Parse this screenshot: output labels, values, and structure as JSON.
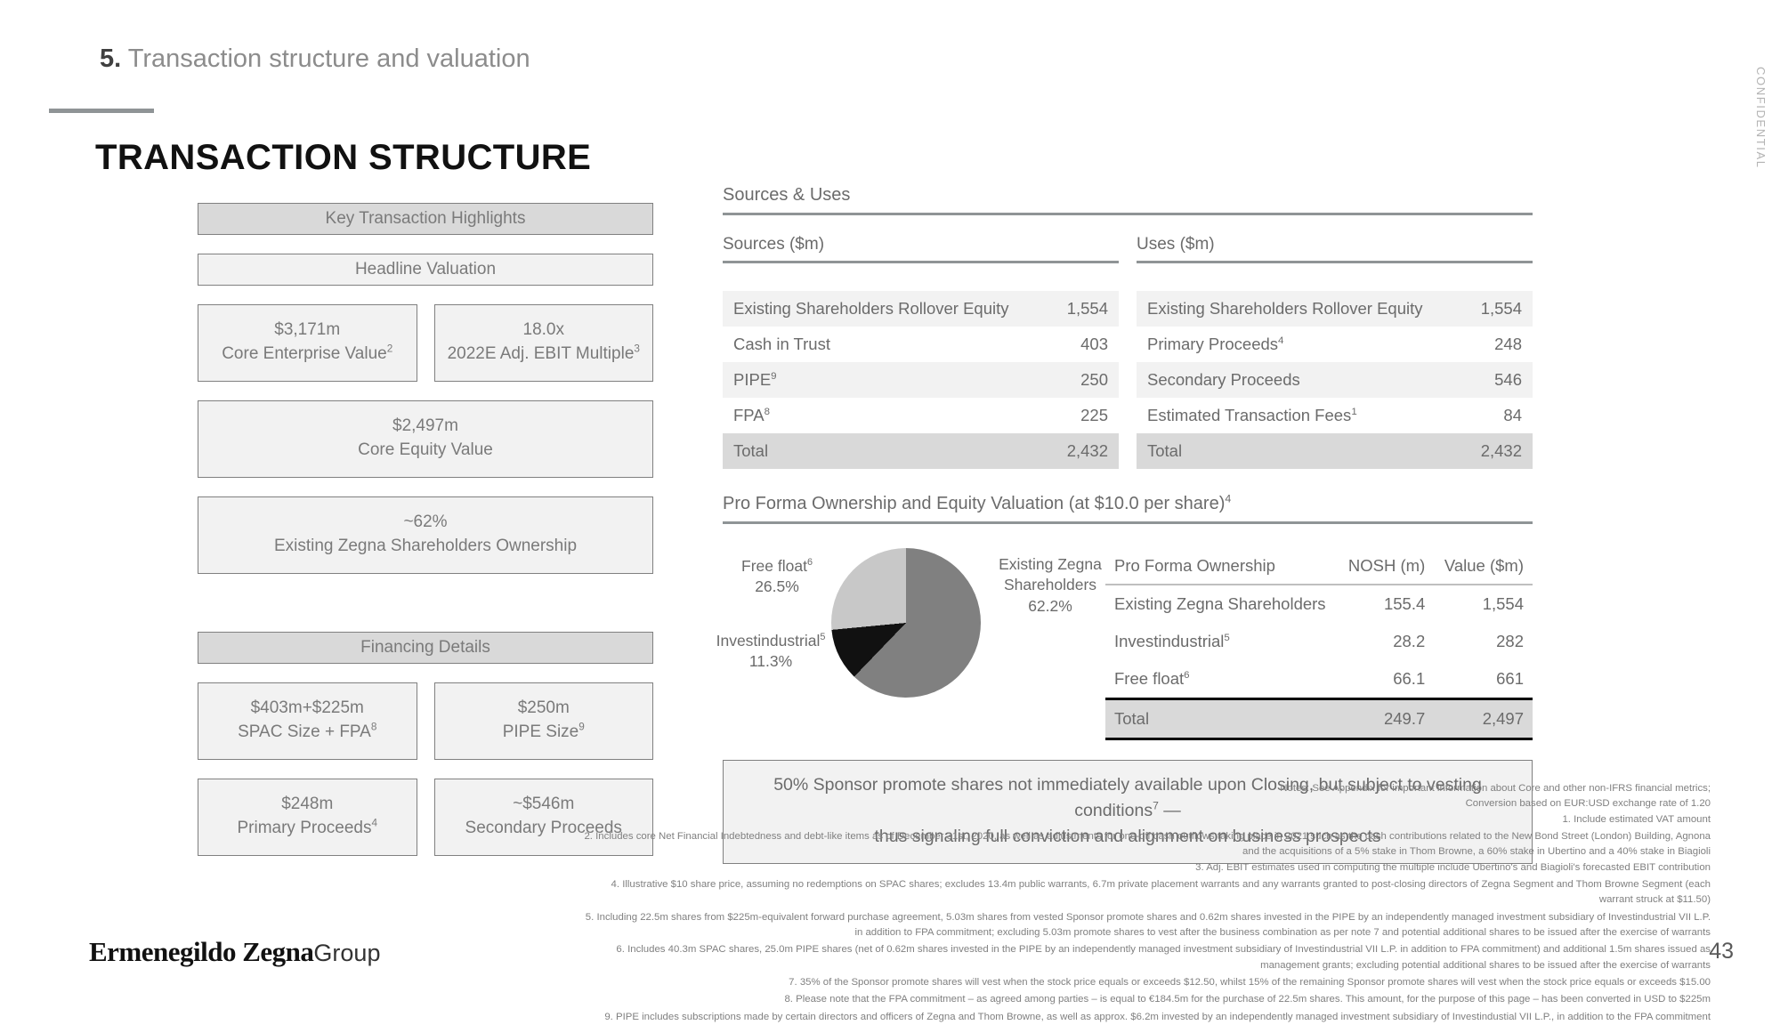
{
  "header": {
    "section_number": "5.",
    "section_title": "Transaction structure and valuation",
    "slide_title": "TRANSACTION STRUCTURE",
    "confidential": "CONFIDENTIAL"
  },
  "left": {
    "key_highlights_band": "Key Transaction Highlights",
    "headline_valuation_band": "Headline Valuation",
    "financing_details_band": "Financing Details",
    "metrics": [
      {
        "value": "$3,171m",
        "label": "Core Enterprise Value",
        "sup": "2"
      },
      {
        "value": "18.0x",
        "label": "2022E Adj. EBIT Multiple",
        "sup": "3"
      },
      {
        "value": "$2,497m",
        "label": "Core Equity Value",
        "sup": ""
      },
      {
        "value": "~62%",
        "label": "Existing Zegna Shareholders Ownership",
        "sup": ""
      },
      {
        "value": "$403m+$225m",
        "label": "SPAC Size + FPA",
        "sup": "8"
      },
      {
        "value": "$250m",
        "label": "PIPE Size",
        "sup": "9"
      },
      {
        "value": "$248m",
        "label": "Primary Proceeds",
        "sup": "4"
      },
      {
        "value": "~$546m",
        "label": "Secondary Proceeds",
        "sup": ""
      }
    ]
  },
  "sources_uses": {
    "block_title": "Sources & Uses",
    "sources_header": "Sources ($m)",
    "uses_header": "Uses ($m)",
    "sources_rows": [
      {
        "label": "Existing Shareholders Rollover Equity",
        "sup": "",
        "value": "1,554"
      },
      {
        "label": "Cash in Trust",
        "sup": "",
        "value": "403"
      },
      {
        "label": "PIPE",
        "sup": "9",
        "value": "250"
      },
      {
        "label": "FPA",
        "sup": "8",
        "value": "225"
      },
      {
        "label": "Total",
        "sup": "",
        "value": "2,432"
      }
    ],
    "uses_rows": [
      {
        "label": "Existing Shareholders Rollover Equity",
        "sup": "",
        "value": "1,554"
      },
      {
        "label": "Primary Proceeds",
        "sup": "4",
        "value": "248"
      },
      {
        "label": "Secondary Proceeds",
        "sup": "",
        "value": "546"
      },
      {
        "label": "Estimated Transaction Fees",
        "sup": "1",
        "value": "84"
      },
      {
        "label": "Total",
        "sup": "",
        "value": "2,432"
      }
    ]
  },
  "pro_forma": {
    "block_title": "Pro Forma Ownership and Equity Valuation (at $10.0 per share)",
    "block_title_sup": "4",
    "columns": [
      "Pro Forma Ownership",
      "NOSH (m)",
      "Value ($m)"
    ],
    "rows": [
      {
        "label": "Existing Zegna Shareholders",
        "sup": "",
        "nosh": "155.4",
        "value": "1,554"
      },
      {
        "label": "Investindustrial",
        "sup": "5",
        "nosh": "28.2",
        "value": "282"
      },
      {
        "label": "Free float",
        "sup": "6",
        "nosh": "66.1",
        "value": "661"
      },
      {
        "label": "Total",
        "sup": "",
        "nosh": "249.7",
        "value": "2,497"
      }
    ],
    "pie_labels": {
      "existing_name": "Existing Zegna",
      "existing_name2": "Shareholders",
      "existing_pct": "62.2%",
      "free_float_name": "Free float",
      "free_float_sup": "6",
      "free_float_pct": "26.5%",
      "investindustrial_name": "Investindustrial",
      "investindustrial_sup": "5",
      "investindustrial_pct": "11.3%"
    }
  },
  "chart_data": {
    "type": "pie",
    "title": "Pro Forma Ownership and Equity Valuation (at $10.0 per share)",
    "categories": [
      "Existing Zegna Shareholders",
      "Investindustrial",
      "Free float"
    ],
    "values": [
      62.2,
      11.3,
      26.5
    ],
    "unit": "%",
    "colors": [
      "#808080",
      "#111111",
      "#c8c8c8"
    ],
    "legend": "data labels",
    "nosh_m": [
      155.4,
      28.2,
      66.1
    ],
    "value_usd_m": [
      1554,
      282,
      661
    ],
    "total_nosh_m": 249.7,
    "total_value_usd_m": 2497
  },
  "callout": {
    "line1": "50% Sponsor promote shares not immediately available upon Closing, but subject to vesting conditions",
    "sup": "7",
    "line1_tail": " —",
    "line2": "thus signaling full conviction and alignment on business prospects"
  },
  "notes": {
    "n0a": "Notes: See Appendix for important information about Core and other non-IFRS financial metrics;",
    "n0b": "Conversion based on EUR:USD exchange rate of 1.20",
    "n1": "1. Include estimated VAT amount",
    "n2a": "2. Includes core Net Financial Indebtedness and debt-like items as of December 31st, 2020, as well as adjustments for one-off cash outflows taking place in 2021 such as the cash contributions related to the New Bond Street (London) Building, Agnona",
    "n2b": "and the acquisitions of a 5% stake in Thom Browne, a 60% stake in Ubertino and a 40% stake in Biagioli",
    "n3": "3. Adj. EBIT estimates used in computing the multiple include Ubertino's and Biagioli's forecasted EBIT contribution",
    "n4a": "4. Illustrative $10 share price, assuming no redemptions on SPAC shares; excludes 13.4m public warrants, 6.7m private placement warrants and any warrants granted to post-closing directors of Zegna Segment and Thom Browne Segment (each",
    "n4b": "warrant struck at $11.50)",
    "n5a": "5. Including 22.5m shares from $225m-equivalent forward purchase agreement, 5.03m shares from vested Sponsor promote shares and 0.62m shares invested in the PIPE by an independently managed investment subsidiary of Investindustrial VII L.P.",
    "n5b": "in addition to FPA commitment; excluding 5.03m promote shares to vest after the business combination as per note 7 and potential additional shares to be issued after the exercise of warrants",
    "n6a": "6. Includes 40.3m SPAC shares, 25.0m PIPE shares (net of 0.62m shares invested in the PIPE by an independently managed investment subsidiary of Investindustrial VII L.P. in addition to FPA commitment) and additional 1.5m shares issued as",
    "n6b": "management grants; excluding potential additional shares to be issued after the exercise of warrants",
    "n7": "7. 35% of the Sponsor promote shares will vest when the stock price equals or exceeds $12.50, whilst 15% of the remaining Sponsor promote shares will vest when the stock price equals or exceeds $15.00",
    "n8": "8. Please note that the FPA commitment – as agreed among parties – is equal to €184.5m for the purchase of 22.5m shares. This amount, for the purpose of this page – has been converted in USD to $225m",
    "n9": "9. PIPE includes subscriptions made by certain directors and officers of Zegna and Thom Browne, as well as approx. $6.2m invested by an independently managed investment subsidiary of Investindustial VII L.P., in addition to the FPA commitment"
  },
  "footer": {
    "logo_main": "Ermenegildo Zegna",
    "logo_sub": "Group",
    "page_number": "43"
  }
}
